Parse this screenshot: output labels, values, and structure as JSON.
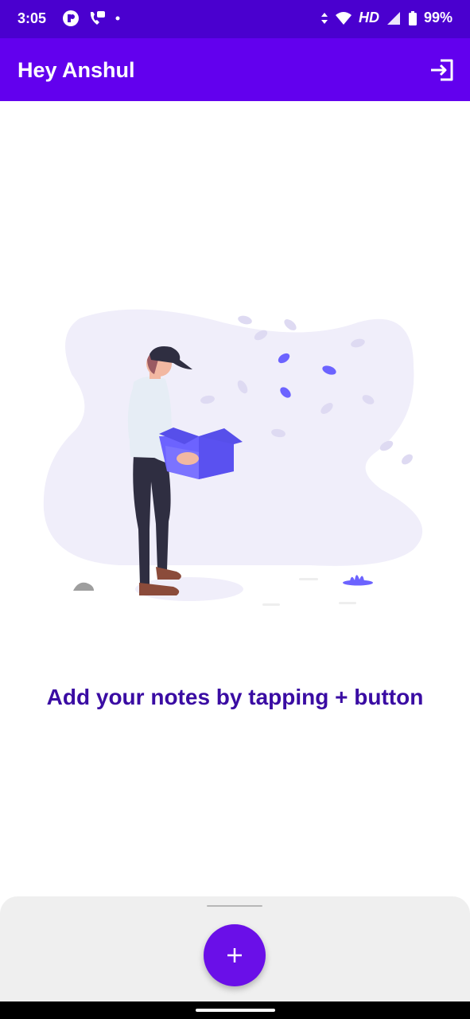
{
  "status_bar": {
    "time": "3:05",
    "network": "HD",
    "battery": "99%",
    "icons": [
      "app-notification-icon",
      "call-icon",
      "dot-icon",
      "data-arrows-icon",
      "wifi-icon",
      "signal-icon",
      "battery-icon"
    ]
  },
  "app_bar": {
    "title": "Hey Anshul",
    "action_icon": "logout-icon"
  },
  "main": {
    "empty_message": "Add your notes by tapping + button",
    "illustration": "person-holding-box-illustration"
  },
  "bottom_sheet": {
    "fab_label": "+",
    "fab_icon": "plus-icon"
  },
  "colors": {
    "status_bar": "#4a00cf",
    "app_bar": "#6200ee",
    "accent": "#6a0fe8",
    "message_text": "#3a0ca3",
    "sheet_bg": "#efefef"
  }
}
